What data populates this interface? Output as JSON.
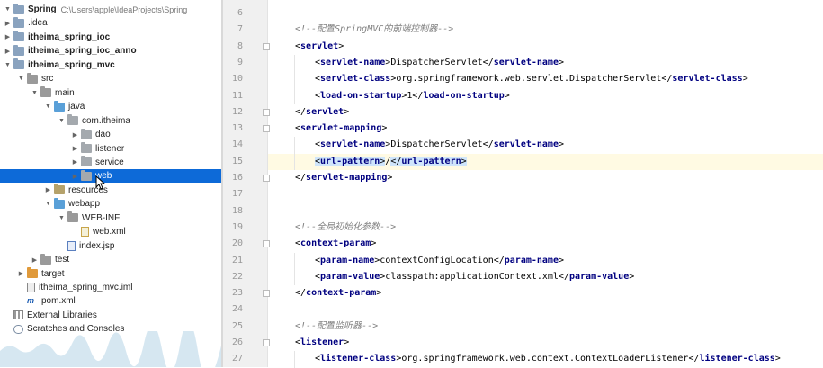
{
  "project_tree": {
    "items": [
      {
        "label": "Spring",
        "hint": "C:\\Users\\apple\\IdeaProjects\\Spring",
        "depth": 0,
        "arrow": "down",
        "icon": "folder",
        "bold": true
      },
      {
        "label": ".idea",
        "depth": 0,
        "arrow": "right",
        "icon": "folder"
      },
      {
        "label": "itheima_spring_ioc",
        "depth": 0,
        "arrow": "right",
        "icon": "folder",
        "bold": true
      },
      {
        "label": "itheima_spring_ioc_anno",
        "depth": 0,
        "arrow": "right",
        "icon": "folder",
        "bold": true
      },
      {
        "label": "itheima_spring_mvc",
        "depth": 0,
        "arrow": "down",
        "icon": "folder",
        "bold": true
      },
      {
        "label": "src",
        "depth": 1,
        "arrow": "down",
        "icon": "folder-plain"
      },
      {
        "label": "main",
        "depth": 2,
        "arrow": "down",
        "icon": "folder-plain"
      },
      {
        "label": "java",
        "depth": 3,
        "arrow": "down",
        "icon": "folder-src"
      },
      {
        "label": "com.itheima",
        "depth": 4,
        "arrow": "down",
        "icon": "folder-pkg"
      },
      {
        "label": "dao",
        "depth": 5,
        "arrow": "right",
        "icon": "folder-pkg"
      },
      {
        "label": "listener",
        "depth": 5,
        "arrow": "right",
        "icon": "folder-pkg"
      },
      {
        "label": "service",
        "depth": 5,
        "arrow": "right",
        "icon": "folder-pkg"
      },
      {
        "label": "web",
        "depth": 5,
        "arrow": "right",
        "icon": "folder-pkg",
        "selected": true
      },
      {
        "label": "resources",
        "depth": 3,
        "arrow": "right",
        "icon": "folder-res"
      },
      {
        "label": "webapp",
        "depth": 3,
        "arrow": "down",
        "icon": "folder-src"
      },
      {
        "label": "WEB-INF",
        "depth": 4,
        "arrow": "down",
        "icon": "folder-plain"
      },
      {
        "label": "web.xml",
        "depth": 5,
        "arrow": "none",
        "icon": "file-xml"
      },
      {
        "label": "index.jsp",
        "depth": 4,
        "arrow": "none",
        "icon": "file-jsp"
      },
      {
        "label": "test",
        "depth": 2,
        "arrow": "right",
        "icon": "folder-plain"
      },
      {
        "label": "target",
        "depth": 1,
        "arrow": "right",
        "icon": "folder-orange"
      },
      {
        "label": "itheima_spring_mvc.iml",
        "depth": 1,
        "arrow": "none",
        "icon": "file-iml"
      },
      {
        "label": "pom.xml",
        "depth": 1,
        "arrow": "none",
        "icon": "maven"
      },
      {
        "label": "External Libraries",
        "depth": 0,
        "arrow": "none",
        "icon": "libraries"
      },
      {
        "label": "Scratches and Consoles",
        "depth": 0,
        "arrow": "none",
        "icon": "scratches"
      }
    ]
  },
  "editor": {
    "current_line": "15",
    "lines": [
      {
        "n": "6",
        "fold": false,
        "indent": 0,
        "parts": []
      },
      {
        "n": "7",
        "fold": false,
        "indent": 0,
        "parts": [
          {
            "t": "<!--配置SpringMVC的前端控制器-->",
            "c": "cmt"
          }
        ]
      },
      {
        "n": "8",
        "fold": true,
        "indent": 0,
        "parts": [
          {
            "t": "<",
            "c": "br"
          },
          {
            "t": "servlet",
            "c": "tag"
          },
          {
            "t": ">",
            "c": "br"
          }
        ]
      },
      {
        "n": "9",
        "fold": false,
        "indent": 1,
        "parts": [
          {
            "t": "<",
            "c": "br"
          },
          {
            "t": "servlet-name",
            "c": "tag"
          },
          {
            "t": ">",
            "c": "br"
          },
          {
            "t": "DispatcherServlet",
            "c": "txt"
          },
          {
            "t": "</",
            "c": "br"
          },
          {
            "t": "servlet-name",
            "c": "tag"
          },
          {
            "t": ">",
            "c": "br"
          }
        ]
      },
      {
        "n": "10",
        "fold": false,
        "indent": 1,
        "parts": [
          {
            "t": "<",
            "c": "br"
          },
          {
            "t": "servlet-class",
            "c": "tag"
          },
          {
            "t": ">",
            "c": "br"
          },
          {
            "t": "org.springframework.web.servlet.DispatcherServlet",
            "c": "txt"
          },
          {
            "t": "</",
            "c": "br"
          },
          {
            "t": "servlet-class",
            "c": "tag"
          },
          {
            "t": ">",
            "c": "br"
          }
        ]
      },
      {
        "n": "11",
        "fold": false,
        "indent": 1,
        "parts": [
          {
            "t": "<",
            "c": "br"
          },
          {
            "t": "load-on-startup",
            "c": "tag"
          },
          {
            "t": ">",
            "c": "br"
          },
          {
            "t": "1",
            "c": "txt"
          },
          {
            "t": "</",
            "c": "br"
          },
          {
            "t": "load-on-startup",
            "c": "tag"
          },
          {
            "t": ">",
            "c": "br"
          }
        ]
      },
      {
        "n": "12",
        "fold": true,
        "indent": 0,
        "parts": [
          {
            "t": "</",
            "c": "br"
          },
          {
            "t": "servlet",
            "c": "tag"
          },
          {
            "t": ">",
            "c": "br"
          }
        ]
      },
      {
        "n": "13",
        "fold": true,
        "indent": 0,
        "parts": [
          {
            "t": "<",
            "c": "br"
          },
          {
            "t": "servlet-mapping",
            "c": "tag"
          },
          {
            "t": ">",
            "c": "br"
          }
        ]
      },
      {
        "n": "14",
        "fold": false,
        "indent": 1,
        "parts": [
          {
            "t": "<",
            "c": "br"
          },
          {
            "t": "servlet-name",
            "c": "tag"
          },
          {
            "t": ">",
            "c": "br"
          },
          {
            "t": "DispatcherServlet",
            "c": "txt"
          },
          {
            "t": "</",
            "c": "br"
          },
          {
            "t": "servlet-name",
            "c": "tag"
          },
          {
            "t": ">",
            "c": "br"
          }
        ]
      },
      {
        "n": "15",
        "fold": false,
        "indent": 1,
        "parts": [
          {
            "t": "<",
            "c": "br hl"
          },
          {
            "t": "url-pattern",
            "c": "tag hl"
          },
          {
            "t": ">",
            "c": "br hl"
          },
          {
            "t": "/",
            "c": "txt"
          },
          {
            "t": "</",
            "c": "br hl"
          },
          {
            "t": "url-pattern",
            "c": "tag hl"
          },
          {
            "t": ">",
            "c": "br hl"
          }
        ]
      },
      {
        "n": "16",
        "fold": true,
        "indent": 0,
        "parts": [
          {
            "t": "</",
            "c": "br"
          },
          {
            "t": "servlet-mapping",
            "c": "tag"
          },
          {
            "t": ">",
            "c": "br"
          }
        ]
      },
      {
        "n": "17",
        "fold": false,
        "indent": 0,
        "parts": []
      },
      {
        "n": "18",
        "fold": false,
        "indent": 0,
        "parts": []
      },
      {
        "n": "19",
        "fold": false,
        "indent": 0,
        "parts": [
          {
            "t": "<!--全局初始化参数-->",
            "c": "cmt"
          }
        ]
      },
      {
        "n": "20",
        "fold": true,
        "indent": 0,
        "parts": [
          {
            "t": "<",
            "c": "br"
          },
          {
            "t": "context-param",
            "c": "tag"
          },
          {
            "t": ">",
            "c": "br"
          }
        ]
      },
      {
        "n": "21",
        "fold": false,
        "indent": 1,
        "parts": [
          {
            "t": "<",
            "c": "br"
          },
          {
            "t": "param-name",
            "c": "tag"
          },
          {
            "t": ">",
            "c": "br"
          },
          {
            "t": "contextConfigLocation",
            "c": "txt"
          },
          {
            "t": "</",
            "c": "br"
          },
          {
            "t": "param-name",
            "c": "tag"
          },
          {
            "t": ">",
            "c": "br"
          }
        ]
      },
      {
        "n": "22",
        "fold": false,
        "indent": 1,
        "parts": [
          {
            "t": "<",
            "c": "br"
          },
          {
            "t": "param-value",
            "c": "tag"
          },
          {
            "t": ">",
            "c": "br"
          },
          {
            "t": "classpath:applicationContext.xml",
            "c": "txt"
          },
          {
            "t": "</",
            "c": "br"
          },
          {
            "t": "param-value",
            "c": "tag"
          },
          {
            "t": ">",
            "c": "br"
          }
        ]
      },
      {
        "n": "23",
        "fold": true,
        "indent": 0,
        "parts": [
          {
            "t": "</",
            "c": "br"
          },
          {
            "t": "context-param",
            "c": "tag"
          },
          {
            "t": ">",
            "c": "br"
          }
        ]
      },
      {
        "n": "24",
        "fold": false,
        "indent": 0,
        "parts": []
      },
      {
        "n": "25",
        "fold": false,
        "indent": 0,
        "parts": [
          {
            "t": "<!--配置监听器-->",
            "c": "cmt"
          }
        ]
      },
      {
        "n": "26",
        "fold": true,
        "indent": 0,
        "parts": [
          {
            "t": "<",
            "c": "br"
          },
          {
            "t": "listener",
            "c": "tag"
          },
          {
            "t": ">",
            "c": "br"
          }
        ]
      },
      {
        "n": "27",
        "fold": false,
        "indent": 1,
        "parts": [
          {
            "t": "<",
            "c": "br"
          },
          {
            "t": "listener-class",
            "c": "tag"
          },
          {
            "t": ">",
            "c": "br"
          },
          {
            "t": "org.springframework.web.context.ContextLoaderListener",
            "c": "txt"
          },
          {
            "t": "</",
            "c": "br"
          },
          {
            "t": "listener-class",
            "c": "tag"
          },
          {
            "t": ">",
            "c": "br"
          }
        ]
      }
    ]
  },
  "colors": {
    "tag": "#000080",
    "comment": "#808080",
    "selection": "#0d6ad8",
    "current_line": "#fffae3",
    "match_highlight": "#cfe5fb"
  }
}
